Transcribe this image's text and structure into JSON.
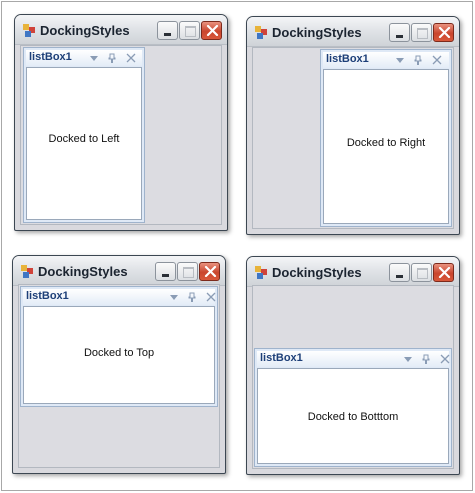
{
  "colors": {
    "title_text": "#1b2430",
    "dock_title": "#1d3f78",
    "client_bg": "#dcdce1",
    "close_button": "#c9452d"
  },
  "windows": [
    {
      "title": "DockingStyles",
      "dock_header": "listBox1",
      "content_label": "Docked to Left",
      "dock": "left"
    },
    {
      "title": "DockingStyles",
      "dock_header": "listBox1",
      "content_label": "Docked to Right",
      "dock": "right"
    },
    {
      "title": "DockingStyles",
      "dock_header": "listBox1",
      "content_label": "Docked to Top",
      "dock": "top"
    },
    {
      "title": "DockingStyles",
      "dock_header": "listBox1",
      "content_label": "Docked to Botttom",
      "dock": "bottom"
    }
  ],
  "icons": {
    "app": "app-window-icon",
    "minimize": "minimize-icon",
    "maximize": "maximize-icon",
    "close": "close-icon",
    "dropdown": "chevron-down-icon",
    "pin": "pin-icon",
    "panel_close": "panel-close-icon"
  }
}
